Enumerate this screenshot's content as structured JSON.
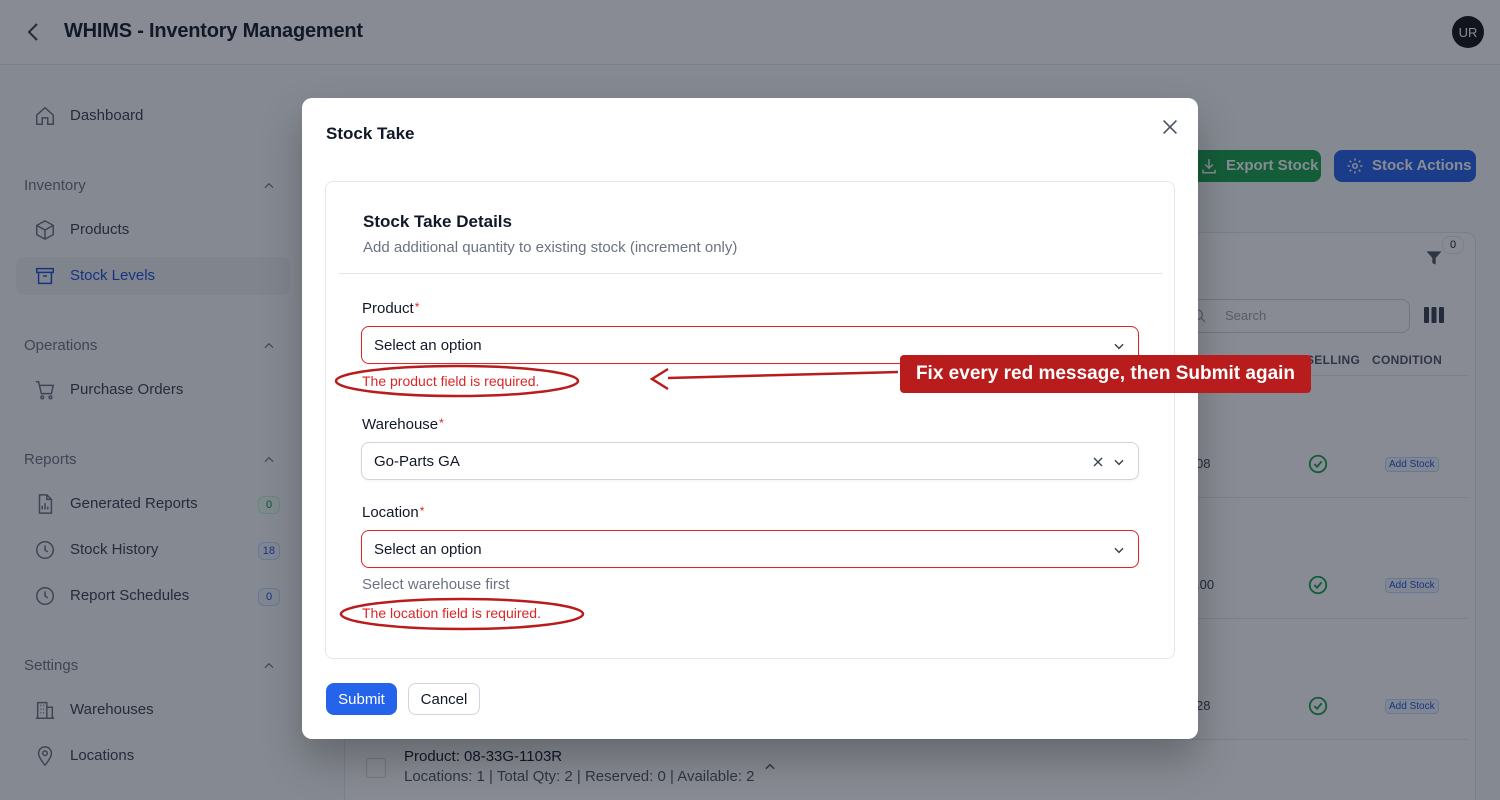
{
  "header": {
    "title": "WHIMS - Inventory Management",
    "avatar_initials": "UR"
  },
  "sidebar": {
    "dashboard": "Dashboard",
    "groups": {
      "inventory": "Inventory",
      "operations": "Operations",
      "reports": "Reports",
      "settings": "Settings"
    },
    "items": {
      "products": "Products",
      "stock_levels": "Stock Levels",
      "purchase_orders": "Purchase Orders",
      "generated_reports": "Generated Reports",
      "generated_reports_count": "0",
      "stock_history": "Stock History",
      "stock_history_count": "18",
      "report_schedules": "Report Schedules",
      "report_schedules_count": "0",
      "warehouses": "Warehouses",
      "locations": "Locations"
    }
  },
  "main": {
    "export_label": "Export Stock",
    "actions_label": "Stock Actions",
    "filter_count": "0",
    "search_placeholder": "Search",
    "col_selling": "SELLING",
    "col_condition": "CONDITION",
    "rows": [
      {
        "value": "08",
        "action": "Add Stock"
      },
      {
        "value": ".00",
        "action": "Add Stock"
      },
      {
        "value": "28",
        "action": "Add Stock"
      }
    ],
    "product_row": {
      "title": "Product: 08-33G-1103R",
      "subtitle": "Locations: 1 | Total Qty: 2 | Reserved: 0 | Available: 2"
    }
  },
  "modal": {
    "title": "Stock Take",
    "section_title": "Stock Take Details",
    "section_desc": "Add additional quantity to existing stock (increment only)",
    "product": {
      "label": "Product",
      "required_mark": "*",
      "value": "Select an option",
      "error": "The product field is required."
    },
    "warehouse": {
      "label": "Warehouse",
      "required_mark": "*",
      "value": "Go-Parts GA"
    },
    "location": {
      "label": "Location",
      "required_mark": "*",
      "value": "Select an option",
      "help": "Select warehouse first",
      "error": "The location field is required."
    },
    "submit_label": "Submit",
    "cancel_label": "Cancel"
  },
  "annotation": {
    "callout": "Fix every red message, then Submit again",
    "color": "#b91c1c"
  },
  "colors": {
    "primary": "#2563eb",
    "success": "#16a34a",
    "error": "#dc2626"
  }
}
